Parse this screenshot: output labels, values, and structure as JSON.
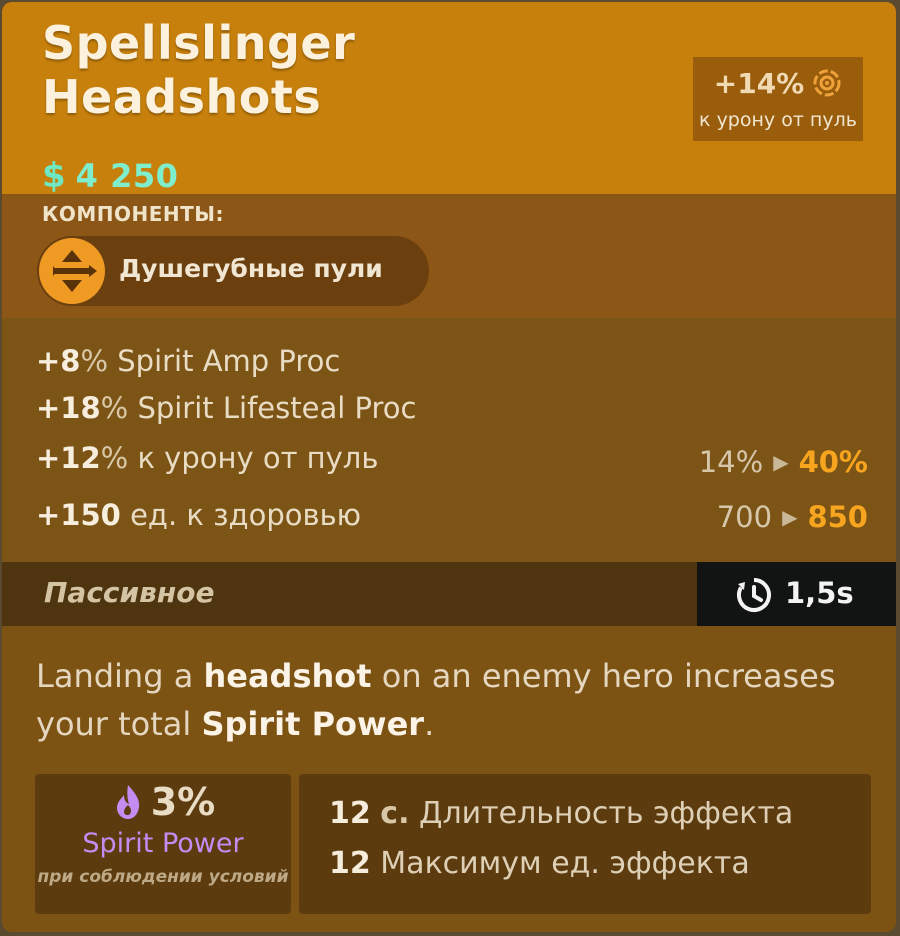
{
  "item": {
    "title": "Spellslinger Headshots",
    "price_symbol": "$",
    "price": "4 250"
  },
  "bonus": {
    "value": "+14%",
    "label": "к урону от пуль",
    "icon": "bullet-target-icon"
  },
  "components": {
    "heading": "КОМПОНЕНТЫ:",
    "items": [
      {
        "name": "Душегубные пули",
        "icon": "soul-bullets-icon"
      }
    ]
  },
  "stats": [
    {
      "value": "+8",
      "unit": "%",
      "label": "Spirit Amp Proc"
    },
    {
      "value": "+18",
      "unit": "%",
      "label": "Spirit Lifesteal Proc"
    },
    {
      "value": "+12",
      "unit": "%",
      "label": "к урону от пуль",
      "old": "14%",
      "new": "40%"
    },
    {
      "value": "+150",
      "unit": "",
      "label": "ед. к здоровью",
      "old": "700",
      "new": "850"
    }
  ],
  "passive": {
    "label": "Пассивное",
    "cooldown": "1,5s",
    "cooldown_icon": "cooldown-clock-icon"
  },
  "description": {
    "p1": "Landing a ",
    "b1": "headshot",
    "p2": " on an enemy hero increases your total ",
    "b2": "Spirit Power",
    "p3": "."
  },
  "spirit_box": {
    "value": "3%",
    "label": "Spirit Power",
    "condition": "при соблюдении условий",
    "icon": "spirit-flame-icon"
  },
  "effects": [
    {
      "value": "12",
      "unit": "с.",
      "label": "Длительность эффекта"
    },
    {
      "value": "12",
      "unit": "",
      "label": "Максимум ед. эффекта"
    }
  ],
  "colors": {
    "header": "#c8800c",
    "accent_orange": "#f7a41f",
    "spirit_purple": "#c38cf1",
    "price_green": "#7eeecc"
  }
}
